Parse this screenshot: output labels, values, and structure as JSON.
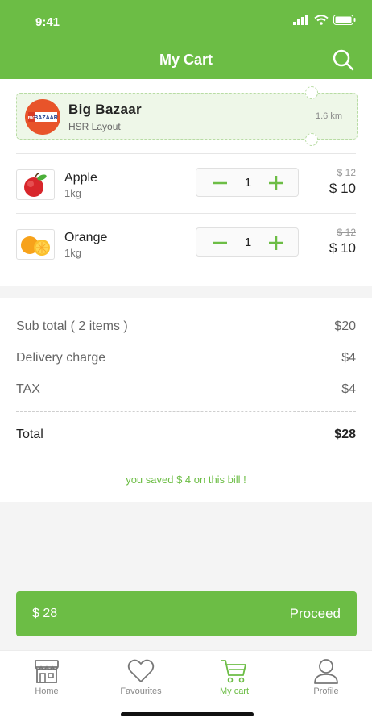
{
  "status_bar": {
    "time": "9:41"
  },
  "header": {
    "title": "My Cart",
    "search_icon": "search-icon"
  },
  "store": {
    "name": "Big Bazaar",
    "area": "HSR Layout",
    "distance": "1.6 km",
    "logo_text": "BIG BAZAAR"
  },
  "items": [
    {
      "name": "Apple",
      "unit": "1kg",
      "qty": "1",
      "old_price": "$ 12",
      "price": "$ 10"
    },
    {
      "name": "Orange",
      "unit": "1kg",
      "qty": "1",
      "old_price": "$ 12",
      "price": "$ 10"
    }
  ],
  "summary": {
    "subtotal_label": "Sub total ( 2 items )",
    "subtotal_value": "$20",
    "delivery_label": "Delivery charge",
    "delivery_value": "$4",
    "tax_label": "TAX",
    "tax_value": "$4",
    "total_label": "Total",
    "total_value": "$28",
    "saved_text": "you saved $ 4 on this bill !"
  },
  "proceed": {
    "amount": "$ 28",
    "label": "Proceed"
  },
  "nav": [
    {
      "label": "Home",
      "icon": "store-icon"
    },
    {
      "label": "Favourites",
      "icon": "heart-icon"
    },
    {
      "label": "My cart",
      "icon": "cart-icon",
      "active": true
    },
    {
      "label": "Profile",
      "icon": "user-icon"
    }
  ],
  "colors": {
    "accent": "#6cbd45",
    "text": "#222222",
    "muted": "#888888"
  }
}
